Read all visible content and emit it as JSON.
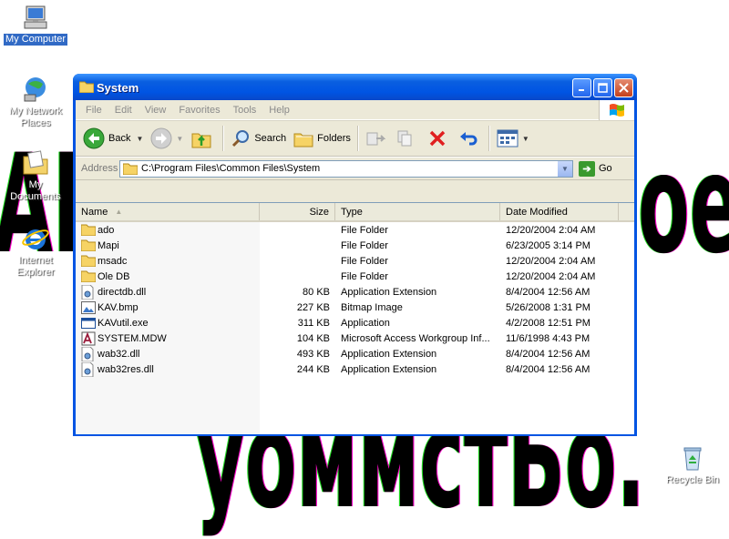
{
  "desktop": {
    "background_text": {
      "top_left": "AI",
      "top_right": "oe",
      "bottom": "уоммстБо."
    },
    "icons": [
      {
        "label": "My Computer",
        "icon": "computer-icon",
        "selected": true
      },
      {
        "label": "My Network Places",
        "icon": "network-places-icon",
        "selected": false
      },
      {
        "label": "My Documents",
        "icon": "documents-folder-icon",
        "selected": false
      },
      {
        "label": "Internet Explorer",
        "icon": "internet-explorer-icon",
        "selected": false
      },
      {
        "label": "Recycle Bin",
        "icon": "recycle-bin-icon",
        "selected": false
      }
    ]
  },
  "window": {
    "title": "System",
    "menu": [
      "File",
      "Edit",
      "View",
      "Favorites",
      "Tools",
      "Help"
    ],
    "toolbar": {
      "back": "Back",
      "search": "Search",
      "folders": "Folders"
    },
    "address": {
      "label": "Address",
      "value": "C:\\Program Files\\Common Files\\System",
      "go": "Go"
    },
    "columns": {
      "name": "Name",
      "size": "Size",
      "type": "Type",
      "date": "Date Modified"
    },
    "files": [
      {
        "name": "ado",
        "size": "",
        "type": "File Folder",
        "date": "12/20/2004 2:04 AM",
        "icon": "folder-icon"
      },
      {
        "name": "Mapi",
        "size": "",
        "type": "File Folder",
        "date": "6/23/2005 3:14 PM",
        "icon": "folder-icon"
      },
      {
        "name": "msadc",
        "size": "",
        "type": "File Folder",
        "date": "12/20/2004 2:04 AM",
        "icon": "folder-icon"
      },
      {
        "name": "Ole DB",
        "size": "",
        "type": "File Folder",
        "date": "12/20/2004 2:04 AM",
        "icon": "folder-icon"
      },
      {
        "name": "directdb.dll",
        "size": "80 KB",
        "type": "Application Extension",
        "date": "8/4/2004 12:56 AM",
        "icon": "dll-file-icon"
      },
      {
        "name": "KAV.bmp",
        "size": "227 KB",
        "type": "Bitmap Image",
        "date": "5/26/2008 1:31 PM",
        "icon": "bitmap-file-icon"
      },
      {
        "name": "KAVutil.exe",
        "size": "311 KB",
        "type": "Application",
        "date": "4/2/2008 12:51 PM",
        "icon": "exe-file-icon"
      },
      {
        "name": "SYSTEM.MDW",
        "size": "104 KB",
        "type": "Microsoft Access Workgroup Inf...",
        "date": "11/6/1998 4:43 PM",
        "icon": "access-file-icon"
      },
      {
        "name": "wab32.dll",
        "size": "493 KB",
        "type": "Application Extension",
        "date": "8/4/2004 12:56 AM",
        "icon": "dll-file-icon"
      },
      {
        "name": "wab32res.dll",
        "size": "244 KB",
        "type": "Application Extension",
        "date": "8/4/2004 12:56 AM",
        "icon": "dll-file-icon"
      }
    ]
  }
}
